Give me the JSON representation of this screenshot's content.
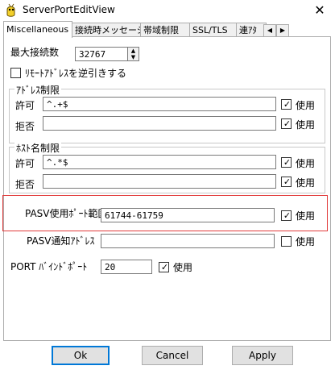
{
  "window": {
    "title": "ServerPortEditView",
    "close_glyph": "✕"
  },
  "tabs": [
    {
      "label": "Miscellaneous",
      "active": true
    },
    {
      "label": "接続時メッセージ",
      "active": false
    },
    {
      "label": "帯域制限",
      "active": false
    },
    {
      "label": "SSL/TLS",
      "active": false
    },
    {
      "label": "連ｱﾀ",
      "active": false
    }
  ],
  "max_connections": {
    "label": "最大接続数",
    "value": "32767"
  },
  "reverse_lookup": {
    "label": "ﾘﾓｰﾄｱﾄﾞﾚｽを逆引きする",
    "checked": false
  },
  "address_group": {
    "title": "ｱﾄﾞﾚｽ制限",
    "allow": {
      "label": "許可",
      "value": "^.+$",
      "use_label": "使用",
      "use_checked": true
    },
    "deny": {
      "label": "拒否",
      "value": "",
      "use_label": "使用",
      "use_checked": true
    }
  },
  "host_group": {
    "title": "ﾎｽﾄ名制限",
    "allow": {
      "label": "許可",
      "value": "^.*$",
      "use_label": "使用",
      "use_checked": true
    },
    "deny": {
      "label": "拒否",
      "value": "",
      "use_label": "使用",
      "use_checked": true
    }
  },
  "pasv_range": {
    "label": "PASV使用ﾎﾟｰﾄ範囲",
    "value": "61744-61759",
    "use_label": "使用",
    "use_checked": true
  },
  "pasv_notify": {
    "label": "PASV通知ｱﾄﾞﾚｽ",
    "value": "",
    "use_label": "使用",
    "use_checked": false
  },
  "port_bind": {
    "label": "PORT ﾊﾞｲﾝﾄﾞﾎﾟｰﾄ",
    "value": "20",
    "use_label": "使用",
    "use_checked": true
  },
  "buttons": {
    "ok": "Ok",
    "cancel": "Cancel",
    "apply": "Apply"
  },
  "colors": {
    "highlight": "#e23b3b",
    "default_button_border": "#0078d7",
    "group_border": "#c8c8c8"
  }
}
